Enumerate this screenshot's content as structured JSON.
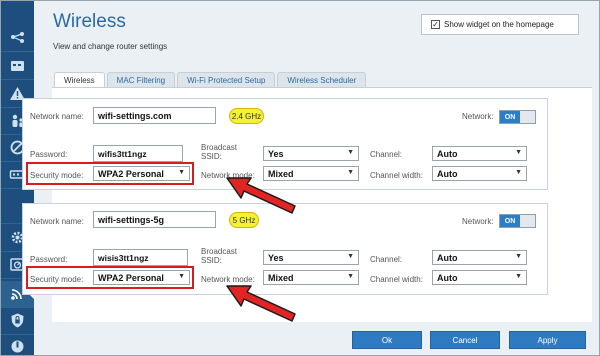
{
  "header": {
    "title": "Wireless",
    "subtitle": "View and change router settings",
    "widget_label": "Show widget on the homepage",
    "widget_checked": true
  },
  "tabs": [
    {
      "label": "Wireless",
      "active": true
    },
    {
      "label": "MAC Filtering",
      "active": false
    },
    {
      "label": "Wi-Fi Protected Setup",
      "active": false
    },
    {
      "label": "Wireless Scheduler",
      "active": false
    }
  ],
  "labels": {
    "network_name": "Network name:",
    "network": "Network:",
    "password": "Password:",
    "broadcast_ssid": "Broadcast SSID:",
    "channel": "Channel:",
    "security_mode": "Security mode:",
    "network_mode": "Network mode:",
    "channel_width": "Channel width:"
  },
  "networks": [
    {
      "name": "wifi-settings.com",
      "band": "2.4 GHz",
      "toggle": "ON",
      "password": "wifis3tt1ngz",
      "broadcast_ssid": "Yes",
      "channel": "Auto",
      "security_mode": "WPA2 Personal",
      "network_mode": "Mixed",
      "channel_width": "Auto"
    },
    {
      "name": "wifi-settings-5g",
      "band": "5 GHz",
      "toggle": "ON",
      "password": "wisis3tt1ngz",
      "broadcast_ssid": "Yes",
      "channel": "Auto",
      "security_mode": "WPA2 Personal",
      "network_mode": "Mixed",
      "channel_width": "Auto"
    }
  ],
  "buttons": {
    "ok": "Ok",
    "cancel": "Cancel",
    "apply": "Apply"
  },
  "sidebar": {
    "items": [
      {
        "icon": "network-map-icon"
      },
      {
        "icon": "apps-icon"
      },
      {
        "icon": "alert-icon"
      },
      {
        "icon": "parental-controls-icon"
      },
      {
        "icon": "block-icon"
      },
      {
        "icon": "media-icon"
      },
      {
        "icon": "settings-gear-icon"
      },
      {
        "icon": "speed-test-icon"
      },
      {
        "icon": "wireless-icon",
        "active": true
      },
      {
        "icon": "security-shield-icon"
      },
      {
        "icon": "troubleshooting-icon"
      }
    ]
  },
  "colors": {
    "sidebar": "#1d4e7e",
    "accent": "#2b6aa3",
    "highlight": "#d51f1f",
    "badge": "#f3f035",
    "toggle_on": "#2b7dc8"
  }
}
